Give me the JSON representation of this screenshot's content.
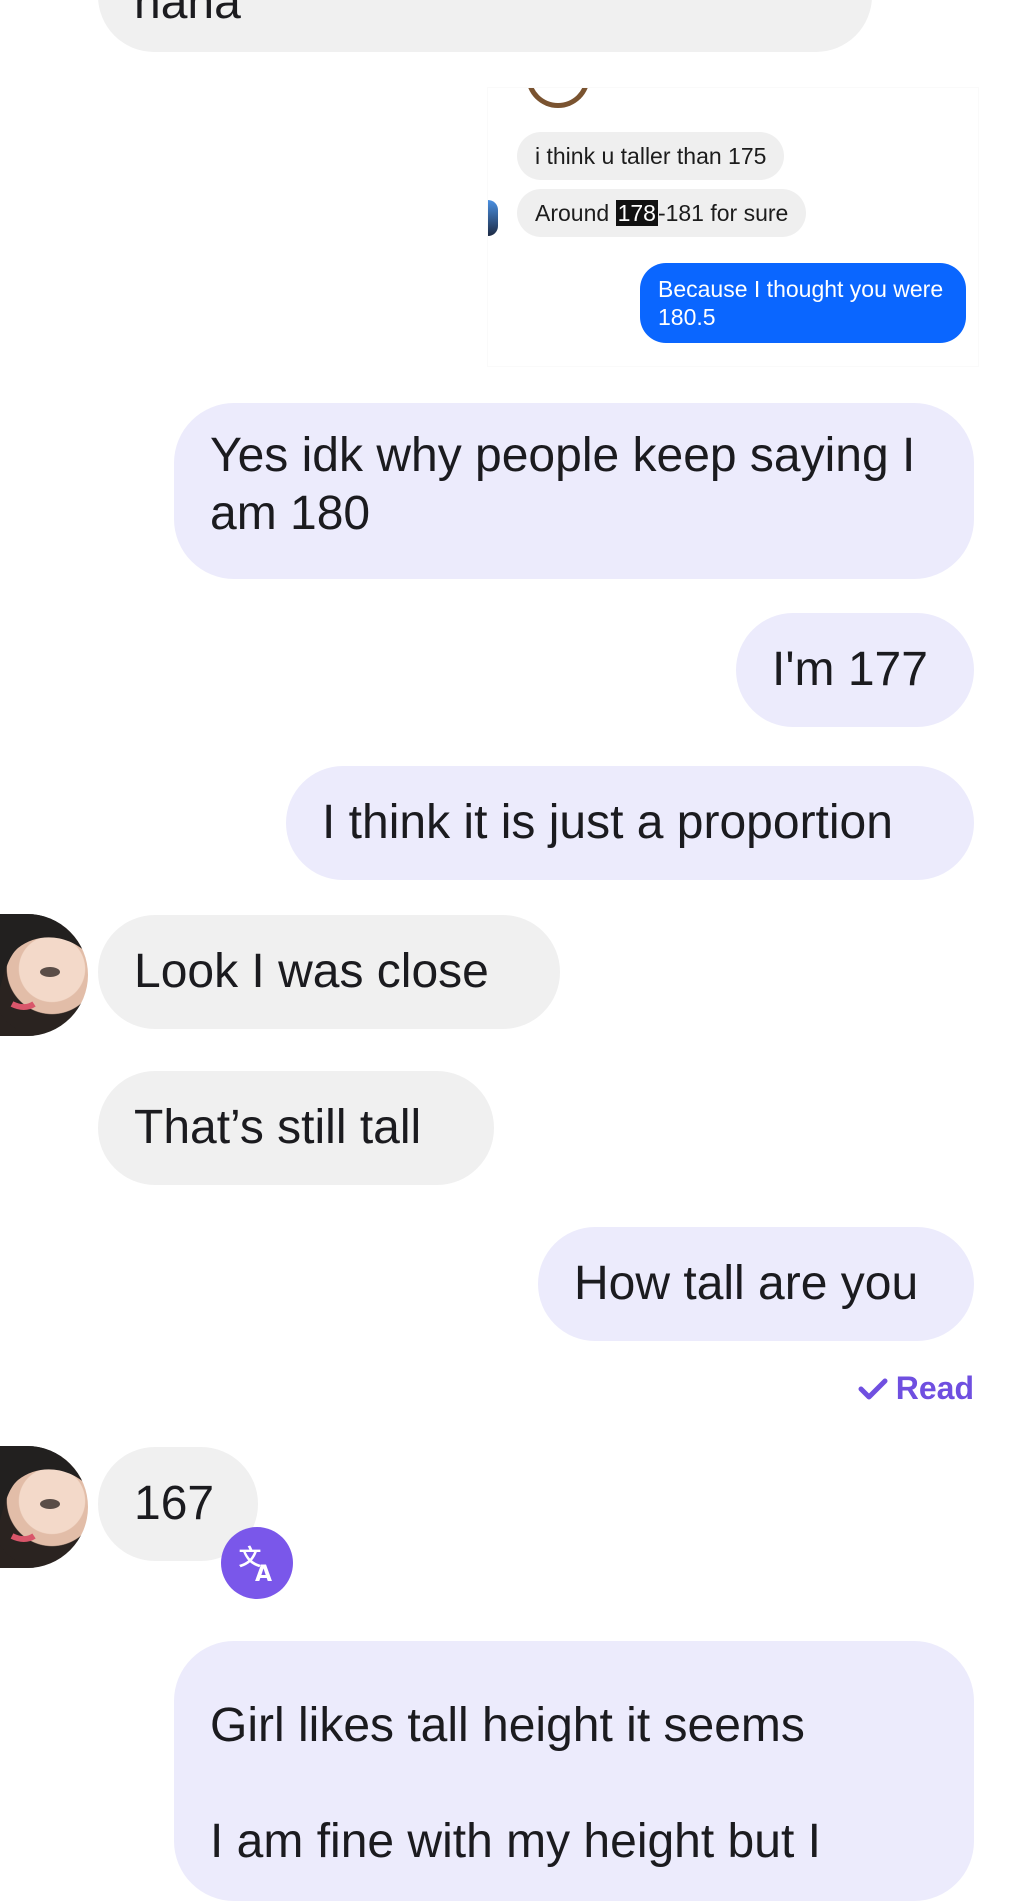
{
  "conversation": {
    "top_partial_message": "haha",
    "screenshot": {
      "msg1": "i think u taller than 175",
      "msg2_before": "Around ",
      "msg2_highlight": "178",
      "msg2_after": "-181 for sure",
      "reply": "Because I thought you were 180.5"
    },
    "messages": [
      {
        "from": "me",
        "text": "Yes idk why people keep saying I am 180"
      },
      {
        "from": "me",
        "text": "I'm 177"
      },
      {
        "from": "me",
        "text": "I think it is just a proportion"
      },
      {
        "from": "them",
        "text": "Look I was close"
      },
      {
        "from": "them",
        "text": "That’s still tall"
      },
      {
        "from": "me",
        "text": "How tall are you"
      },
      {
        "from": "them",
        "text": "167"
      },
      {
        "from": "me",
        "text": "Girl likes tall height it seems"
      },
      {
        "from": "me",
        "text": "I am fine with my height but I"
      }
    ],
    "read_status": "Read"
  },
  "colors": {
    "incoming_bubble": "#f0f0f0",
    "outgoing_bubble": "#ecebfc",
    "accent": "#7a57ea",
    "messenger_blue": "#0a66ff"
  },
  "icons": [
    "checkmark-icon",
    "translate-icon",
    "contact-avatar"
  ]
}
